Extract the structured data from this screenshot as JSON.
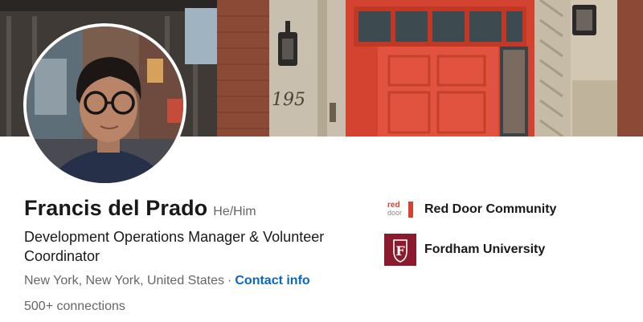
{
  "profile": {
    "name": "Francis del Prado",
    "pronouns": "He/Him",
    "headline": "Development Operations Manager & Volunteer Coordinator",
    "location": "New York, New York, United States",
    "separator": "·",
    "contact_link": "Contact info",
    "connections": "500+ connections"
  },
  "banner": {
    "building_number": "195"
  },
  "organizations": [
    {
      "name": "Red Door Community",
      "logo_text_top": "red",
      "logo_text_bottom": "door",
      "logo_icon": "red-door-logo"
    },
    {
      "name": "Fordham University",
      "logo_letters": "F",
      "logo_icon": "fordham-logo"
    }
  ],
  "colors": {
    "link": "#0a66c2",
    "door_red": "#e1533f",
    "fordham_maroon": "#8b1b2c",
    "secondary_text": "#666666"
  }
}
